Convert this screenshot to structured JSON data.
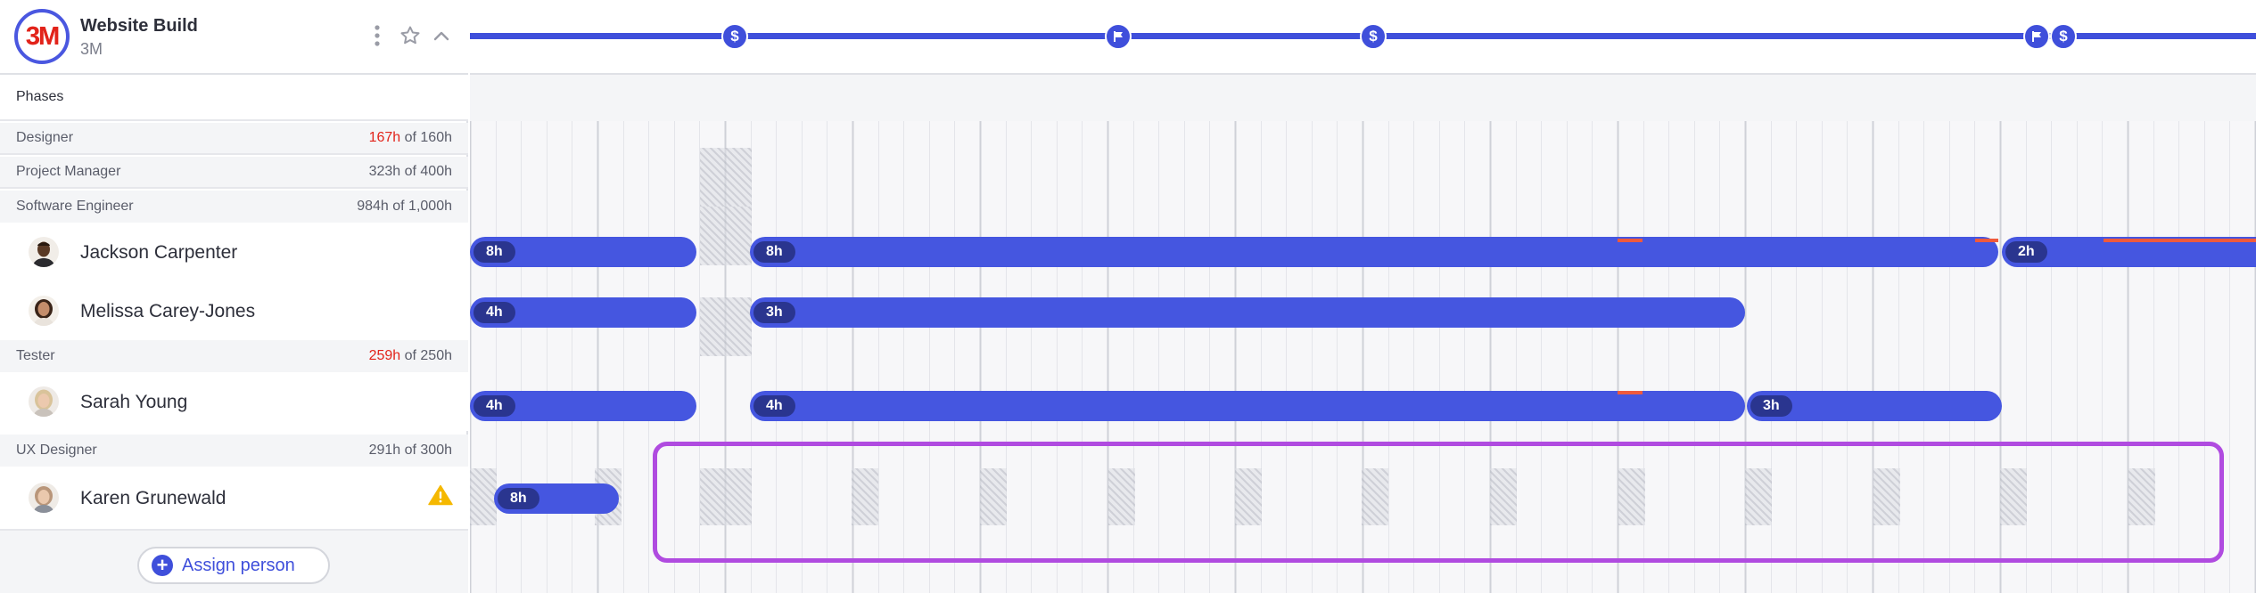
{
  "project": {
    "title": "Website Build",
    "client": "3M",
    "logo_text": "3M"
  },
  "header_icons": [
    "kebab-menu-icon",
    "star-icon",
    "chevron-up-icon"
  ],
  "phases_label": "Phases",
  "roles": [
    {
      "name": "Designer",
      "used": "167h",
      "total": "of 160h",
      "over": true
    },
    {
      "name": "Project Manager",
      "used": "323h",
      "total": "of 400h",
      "over": false
    },
    {
      "name": "Software Engineer",
      "used": "984h",
      "total": "of 1,000h",
      "over": false
    },
    {
      "name": "Tester",
      "used": "259h",
      "total": "of 250h",
      "over": true
    },
    {
      "name": "UX Designer",
      "used": "291h",
      "total": "of 300h",
      "over": false
    }
  ],
  "people": [
    {
      "name": "Jackson Carpenter",
      "role": "Software Engineer",
      "bars": [
        "8h",
        "8h",
        "2h"
      ]
    },
    {
      "name": "Melissa Carey-Jones",
      "role": "Software Engineer",
      "bars": [
        "4h",
        "3h"
      ]
    },
    {
      "name": "Sarah Young",
      "role": "Tester",
      "bars": [
        "4h",
        "4h",
        "3h"
      ]
    },
    {
      "name": "Karen Grunewald",
      "role": "UX Designer",
      "bars": [
        "8h"
      ],
      "warning": true
    }
  ],
  "assign_button": "Assign person",
  "milestones": [
    "dollar-icon",
    "flag-icon",
    "dollar-icon",
    "flag-icon",
    "dollar-icon"
  ],
  "colors": {
    "accent": "#3f4fdb",
    "bar": "#4556e0",
    "pill": "#2a358f",
    "over": "#e2231a",
    "selection": "#b04be0",
    "warning": "#f5b800"
  }
}
